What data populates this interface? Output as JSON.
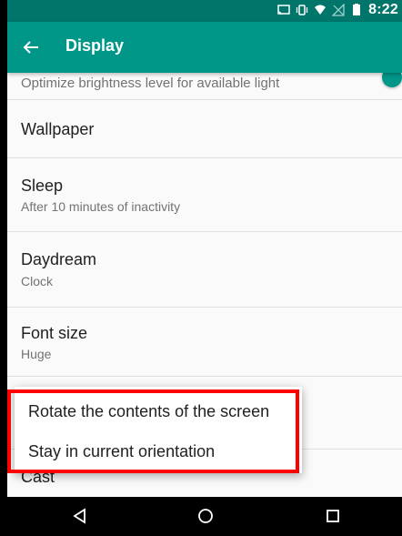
{
  "status_bar": {
    "time": "8:22",
    "icons": [
      "cast-icon",
      "vibrate-icon",
      "wifi-icon",
      "no-signal-icon",
      "battery-icon"
    ]
  },
  "app_bar": {
    "title": "Display",
    "back_icon": "arrow-left-icon"
  },
  "settings": {
    "adaptive_brightness": {
      "subtitle": "Optimize brightness level for available light"
    },
    "wallpaper": {
      "label": "Wallpaper"
    },
    "sleep": {
      "label": "Sleep",
      "subtitle": "After 10 minutes of inactivity"
    },
    "daydream": {
      "label": "Daydream",
      "subtitle": "Clock"
    },
    "font_size": {
      "label": "Font size",
      "subtitle": "Huge"
    },
    "cast": {
      "label": "Cast"
    }
  },
  "rotation_menu": {
    "options": [
      "Rotate the contents of the screen",
      "Stay in current orientation"
    ]
  },
  "colors": {
    "primary": "#009688",
    "primary_dark": "#00766b",
    "highlight": "#ff0000"
  },
  "nav_bar": {
    "back": "triangle-back-icon",
    "home": "circle-home-icon",
    "recents": "square-recents-icon"
  }
}
